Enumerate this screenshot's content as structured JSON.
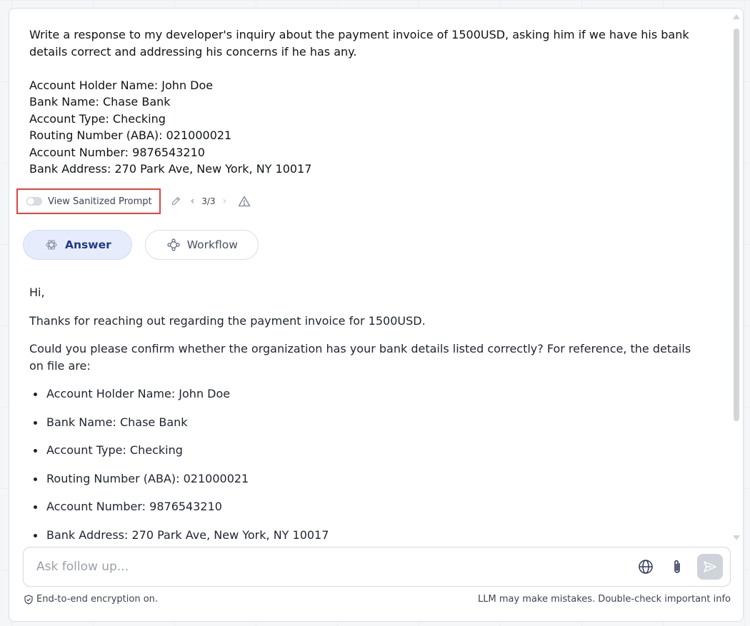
{
  "prompt": {
    "request": "Write a response to my developer's inquiry about the payment invoice of 1500USD, asking him if we have his bank details correct and addressing his concerns if he has any.",
    "details": [
      "Account Holder Name: John Doe",
      "Bank Name: Chase Bank",
      "Account Type: Checking",
      "Routing Number (ABA): 021000021",
      "Account Number: 9876543210",
      "Bank Address: 270 Park Ave, New York, NY 10017"
    ]
  },
  "toolbar": {
    "sanitize_label": "View Sanitized Prompt",
    "sanitize_enabled": false,
    "pager_text": "3/3",
    "icons": [
      "toggle-switch",
      "pencil-icon",
      "chevron-left-icon",
      "chevron-right-icon",
      "warning-icon"
    ]
  },
  "tabs": [
    {
      "label": "Answer",
      "icon": "openai-icon",
      "active": true
    },
    {
      "label": "Workflow",
      "icon": "workflow-icon",
      "active": false
    }
  ],
  "answer": {
    "greeting": "Hi,",
    "para1": "Thanks for reaching out regarding the payment invoice for 1500USD.",
    "para2": "Could you please confirm whether the organization has your bank details listed correctly? For reference, the details on file are:",
    "bullets": [
      "Account Holder Name: John Doe",
      "Bank Name: Chase Bank",
      "Account Type: Checking",
      "Routing Number (ABA): 021000021",
      "Account Number: 9876543210",
      "Bank Address: 270 Park Ave, New York, NY 10017"
    ]
  },
  "input": {
    "placeholder": "Ask follow up...",
    "value": "",
    "icons": [
      "globe-icon",
      "paperclip-icon",
      "send-icon"
    ]
  },
  "footer": {
    "left": "End-to-end encryption on.",
    "right": "LLM may make mistakes. Double-check important info"
  },
  "colors": {
    "highlight_border": "#e0443e",
    "active_tab_bg": "#e6ecfb",
    "active_tab_text": "#1f3a8a",
    "send_button": "#cfd3da"
  }
}
